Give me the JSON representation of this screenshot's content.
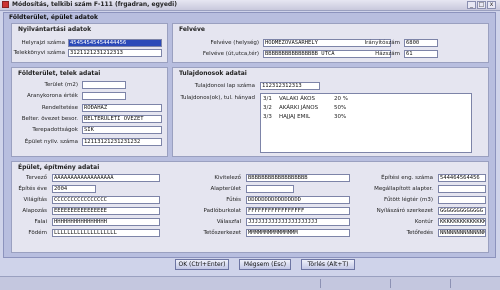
{
  "window": {
    "title": "Módosítás, telkibi szám F-111 (frgadran, egyedi)",
    "btn_min": "_",
    "btn_max": "□",
    "btn_close": "x"
  },
  "panel": {
    "title": "Földterület, épület adatok"
  },
  "nyilv": {
    "title": "Nyilvántartási adatok",
    "helyrajzi_label": "Helyrajzi száma",
    "helyrajzi_value": "45454545454444456",
    "telekkonyvi_label": "Telekkönyvi száma",
    "telekkonyvi_value": "3121121231212313"
  },
  "felveve": {
    "title": "Felvéve",
    "helyseg_label": "Felvéve (helység)",
    "helyseg_value": "HÓDMEZŐVÁSÁRHELY",
    "iranyito_label": "Irányítószám",
    "iranyito_value": "6800",
    "utca_label": "Felvéve (út,utca,tér)",
    "utca_value": "BBBBBBBBBBBBBBBB UTCA",
    "hazszam_label": "Házszám",
    "hazszam_value": "61"
  },
  "foldterulet": {
    "title": "Földterület, telek adatai",
    "terulet_label": "Terület (m2)",
    "terulet_value": "",
    "aranykorona_label": "Aranykorona érték",
    "aranykorona_value": "",
    "rendeltetes_label": "Rendeltetése",
    "rendeltetes_value": "ROÐAHÁZ",
    "belter_label": "Belter. övezet besor.",
    "belter_value": "BELTERÜLETI ÖVEZET",
    "terepadottsag_label": "Terepadottságok",
    "terepadottsag_value": "SÍK",
    "epulet_nyilv_label": "Épület nyilv. száma",
    "epulet_nyilv_value": "12113121231231232"
  },
  "tulajdonosok": {
    "title": "Tulajdonosok adatai",
    "lapszam_label": "Tulajdonosi lap száma",
    "lapszam_value": "112312312313",
    "tulajdonos_label": "Tulajdonos(ok), tul. hányad",
    "rows": [
      {
        "num": "3/1",
        "name": "VALAKI ÁKOS",
        "share": "20 %"
      },
      {
        "num": "3/2",
        "name": "AKÁRKI JÁNOS",
        "share": "50%"
      },
      {
        "num": "3/3",
        "name": "HAJJAJ EMIL",
        "share": "30%"
      }
    ]
  },
  "epulet": {
    "title": "Épület, építmény adatai",
    "col1": [
      {
        "label": "Tervező",
        "value": "AAAAAAAAAAAAAAAAAA"
      },
      {
        "label": "Építés éve",
        "value": "2004"
      },
      {
        "label": "Világítás",
        "value": "CCCCCCCCCCCCCCCC"
      },
      {
        "label": "Alapozás",
        "value": "EEEEEEEEEEEEEEEE"
      },
      {
        "label": "Falai",
        "value": "HHHHHHHHHHHHHHHH"
      },
      {
        "label": "Födém",
        "value": "LLLLLLLLLLLLLLLLLLL"
      }
    ],
    "col2": [
      {
        "label": "Kivitelező",
        "value": "BBBBBBBBBBBBBBBBBB"
      },
      {
        "label": "Alapterület",
        "value": ""
      },
      {
        "label": "Fűtés",
        "value": "DDDDDDDDDDDDDDDD"
      },
      {
        "label": "Padlóburkolat",
        "value": "FFFFFFFFFFFFFFFFF"
      },
      {
        "label": "Válaszfal",
        "value": "JJJJJJJJJJJJJJJJJJJJJ"
      },
      {
        "label": "Tetőszerkezet",
        "value": "MMMMMMMMMMMMMMM"
      }
    ],
    "col3": [
      {
        "label": "Építési eng. száma",
        "value": "544464564456"
      },
      {
        "label": "Megállapított alapter.",
        "value": ""
      },
      {
        "label": "Fűtött légtér (m3)",
        "value": ""
      },
      {
        "label": "Nyílászáró szerkezet",
        "value": "GGGGGGGGGGGGG"
      },
      {
        "label": "Kontúr",
        "value": "KKKKKKKKKKKKKK"
      },
      {
        "label": "Tetőfedés",
        "value": "NNNNNNNNNNNNNN"
      }
    ]
  },
  "buttons": {
    "ok": "OK (Ctrl+Enter)",
    "cancel": "Mégsem (Esc)",
    "delete": "Törlés (Alt+T)"
  }
}
